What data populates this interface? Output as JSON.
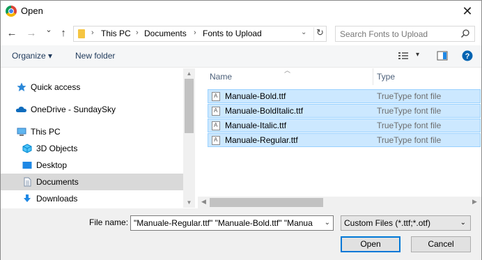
{
  "window": {
    "title": "Open"
  },
  "nav": {
    "back": "←",
    "forward": "→",
    "recent": "⌄",
    "up": "↑",
    "address": [
      "This PC",
      "Documents",
      "Fonts to Upload"
    ],
    "separator": "›",
    "address_drop": "⌄",
    "refresh": "↻",
    "search_placeholder": "Search Fonts to Upload"
  },
  "toolbar": {
    "organize": "Organize ▾",
    "new_folder": "New folder",
    "view_drop": "▾"
  },
  "sidebar": {
    "items": [
      {
        "label": "Quick access",
        "icon": "star-icon"
      },
      {
        "label": "OneDrive - SundaySky",
        "icon": "cloud-icon"
      },
      {
        "label": "This PC",
        "icon": "computer-icon"
      },
      {
        "label": "3D Objects",
        "icon": "cube-icon"
      },
      {
        "label": "Desktop",
        "icon": "desktop-icon"
      },
      {
        "label": "Documents",
        "icon": "documents-icon",
        "selected": true
      },
      {
        "label": "Downloads",
        "icon": "download-arrow-icon"
      }
    ]
  },
  "files": {
    "columns": {
      "name": "Name",
      "type": "Type"
    },
    "rows": [
      {
        "name": "Manuale-Bold.ttf",
        "type": "TrueType font file"
      },
      {
        "name": "Manuale-BoldItalic.ttf",
        "type": "TrueType font file"
      },
      {
        "name": "Manuale-Italic.ttf",
        "type": "TrueType font file"
      },
      {
        "name": "Manuale-Regular.ttf",
        "type": "TrueType font file"
      }
    ]
  },
  "footer": {
    "file_name_label": "File name:",
    "file_name_value": "\"Manuale-Regular.ttf\" \"Manuale-Bold.ttf\" \"Manua",
    "file_type": "Custom Files (*.ttf;*.otf)",
    "open": "Open",
    "cancel": "Cancel"
  },
  "colors": {
    "selection": "#cce8ff",
    "selection_border": "#99d1ff",
    "primary_border": "#0078d7",
    "help": "#0063b1"
  }
}
